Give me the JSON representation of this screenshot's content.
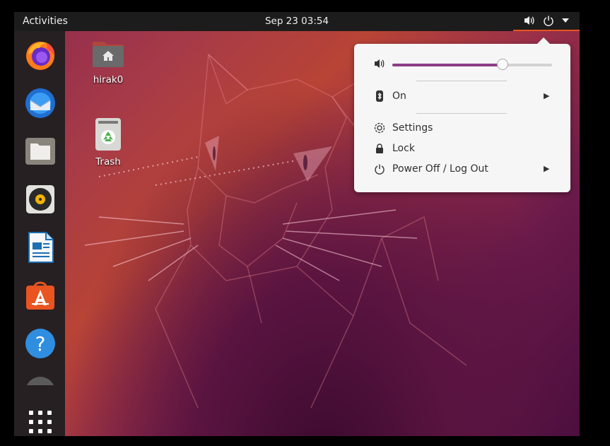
{
  "topbar": {
    "activities_label": "Activities",
    "clock": "Sep 23  03:54",
    "icons": [
      "volume-icon",
      "power-icon",
      "dropdown-arrow-icon"
    ]
  },
  "dock": {
    "items": [
      {
        "name": "Firefox",
        "icon": "firefox-icon"
      },
      {
        "name": "Thunderbird",
        "icon": "thunderbird-icon"
      },
      {
        "name": "Files",
        "icon": "files-icon"
      },
      {
        "name": "Rhythmbox",
        "icon": "rhythmbox-icon"
      },
      {
        "name": "LibreOffice Writer",
        "icon": "writer-icon"
      },
      {
        "name": "Ubuntu Software",
        "icon": "software-icon"
      },
      {
        "name": "Help",
        "icon": "help-icon"
      },
      {
        "name": "Show Applications",
        "icon": "app-grid-icon"
      }
    ]
  },
  "desktop": {
    "home_label": "hirak0",
    "trash_label": "Trash"
  },
  "menu": {
    "volume_level": 0.69,
    "bluetooth_label": "On",
    "settings_label": "Settings",
    "lock_label": "Lock",
    "power_label": "Power Off / Log Out"
  },
  "colors": {
    "accent": "#e95420",
    "slider_fill": "#8c3d88",
    "topbar": "#1c1c1c",
    "dock": "#262023"
  }
}
